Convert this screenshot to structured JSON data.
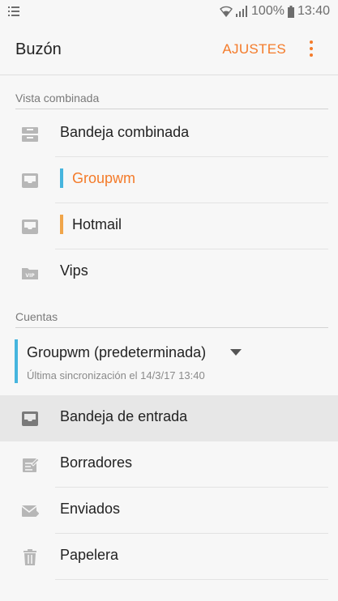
{
  "status_bar": {
    "battery": "100%",
    "time": "13:40",
    "icons": [
      "menu-lines-icon",
      "wifi-icon",
      "signal-icon",
      "battery-icon"
    ]
  },
  "app_bar": {
    "title": "Buzón",
    "settings_label": "AJUSTES",
    "more_icon": "more-vert-icon",
    "accent_color": "#f47b2a"
  },
  "combined_section": {
    "header": "Vista combinada",
    "items": [
      {
        "label": "Bandeja combinada",
        "icon": "combined-inbox-icon"
      },
      {
        "label": "Groupwm",
        "icon": "inbox-icon",
        "bar_color": "#46b5de",
        "selected": true
      },
      {
        "label": "Hotmail",
        "icon": "inbox-icon",
        "bar_color": "#f0a54a"
      },
      {
        "label": "Vips",
        "icon": "vip-folder-icon"
      }
    ]
  },
  "accounts_section": {
    "header": "Cuentas",
    "account": {
      "name": "Groupwm (predeterminada)",
      "sync_text": "Última sincronización el 14/3/17  13:40",
      "bar_color": "#46b5de"
    },
    "folders": [
      {
        "label": "Bandeja de entrada",
        "icon": "inbox-icon",
        "active": true
      },
      {
        "label": "Borradores",
        "icon": "drafts-icon"
      },
      {
        "label": "Enviados",
        "icon": "sent-icon"
      },
      {
        "label": "Papelera",
        "icon": "trash-icon"
      }
    ]
  }
}
